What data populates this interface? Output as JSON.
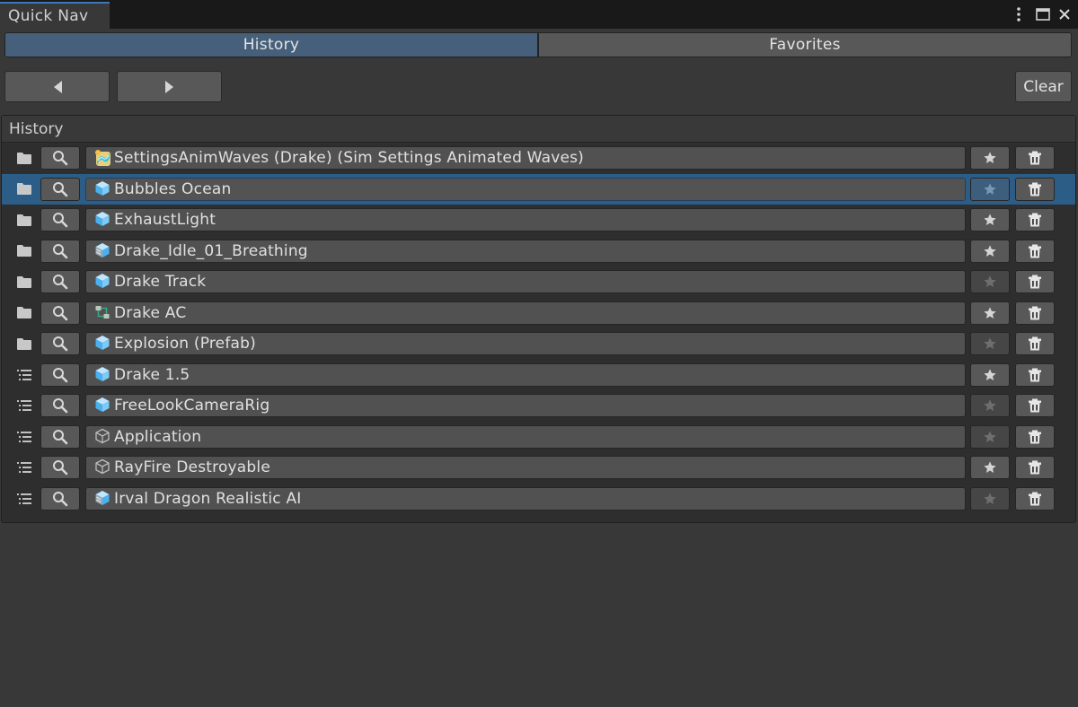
{
  "window": {
    "tab_title": "Quick Nav",
    "menu_icon": "kebab-menu-icon",
    "maximize_icon": "maximize-icon",
    "close_icon": "close-icon"
  },
  "tabs": [
    {
      "label": "History",
      "active": true
    },
    {
      "label": "Favorites",
      "active": false
    }
  ],
  "toolbar": {
    "back_icon": "triangle-left-icon",
    "forward_icon": "triangle-right-icon",
    "clear_label": "Clear"
  },
  "colors": {
    "active_tab": "#46607c",
    "selection": "#2c5d87",
    "window_accent": "#3a79bb"
  },
  "history": {
    "header": "History",
    "items": [
      {
        "type_icon": "folder-icon",
        "object_icon": "scriptable-object-waves-icon",
        "label": "SettingsAnimWaves (Drake) (Sim Settings Animated Waves)",
        "favorite": true,
        "selected": false
      },
      {
        "type_icon": "folder-icon",
        "object_icon": "prefab-icon",
        "label": "Bubbles Ocean",
        "favorite": false,
        "selected": true
      },
      {
        "type_icon": "folder-icon",
        "object_icon": "prefab-icon",
        "label": "ExhaustLight",
        "favorite": true,
        "selected": false
      },
      {
        "type_icon": "folder-icon",
        "object_icon": "model-prefab-icon",
        "label": "Drake_Idle_01_Breathing",
        "favorite": true,
        "selected": false
      },
      {
        "type_icon": "folder-icon",
        "object_icon": "prefab-icon",
        "label": "Drake Track",
        "favorite": false,
        "selected": false
      },
      {
        "type_icon": "folder-icon",
        "object_icon": "animator-controller-icon",
        "label": "Drake AC",
        "favorite": true,
        "selected": false
      },
      {
        "type_icon": "folder-icon",
        "object_icon": "prefab-icon",
        "label": "Explosion (Prefab)",
        "favorite": false,
        "selected": false
      },
      {
        "type_icon": "hierarchy-icon",
        "object_icon": "prefab-icon",
        "label": "Drake 1.5",
        "favorite": true,
        "selected": false
      },
      {
        "type_icon": "hierarchy-icon",
        "object_icon": "prefab-icon",
        "label": "FreeLookCameraRig",
        "favorite": false,
        "selected": false
      },
      {
        "type_icon": "hierarchy-icon",
        "object_icon": "gameobject-icon",
        "label": "Application",
        "favorite": false,
        "selected": false
      },
      {
        "type_icon": "hierarchy-icon",
        "object_icon": "gameobject-icon",
        "label": "RayFire Destroyable",
        "favorite": true,
        "selected": false
      },
      {
        "type_icon": "hierarchy-icon",
        "object_icon": "model-prefab-icon",
        "label": "Irval Dragon Realistic AI",
        "favorite": false,
        "selected": false
      }
    ]
  }
}
